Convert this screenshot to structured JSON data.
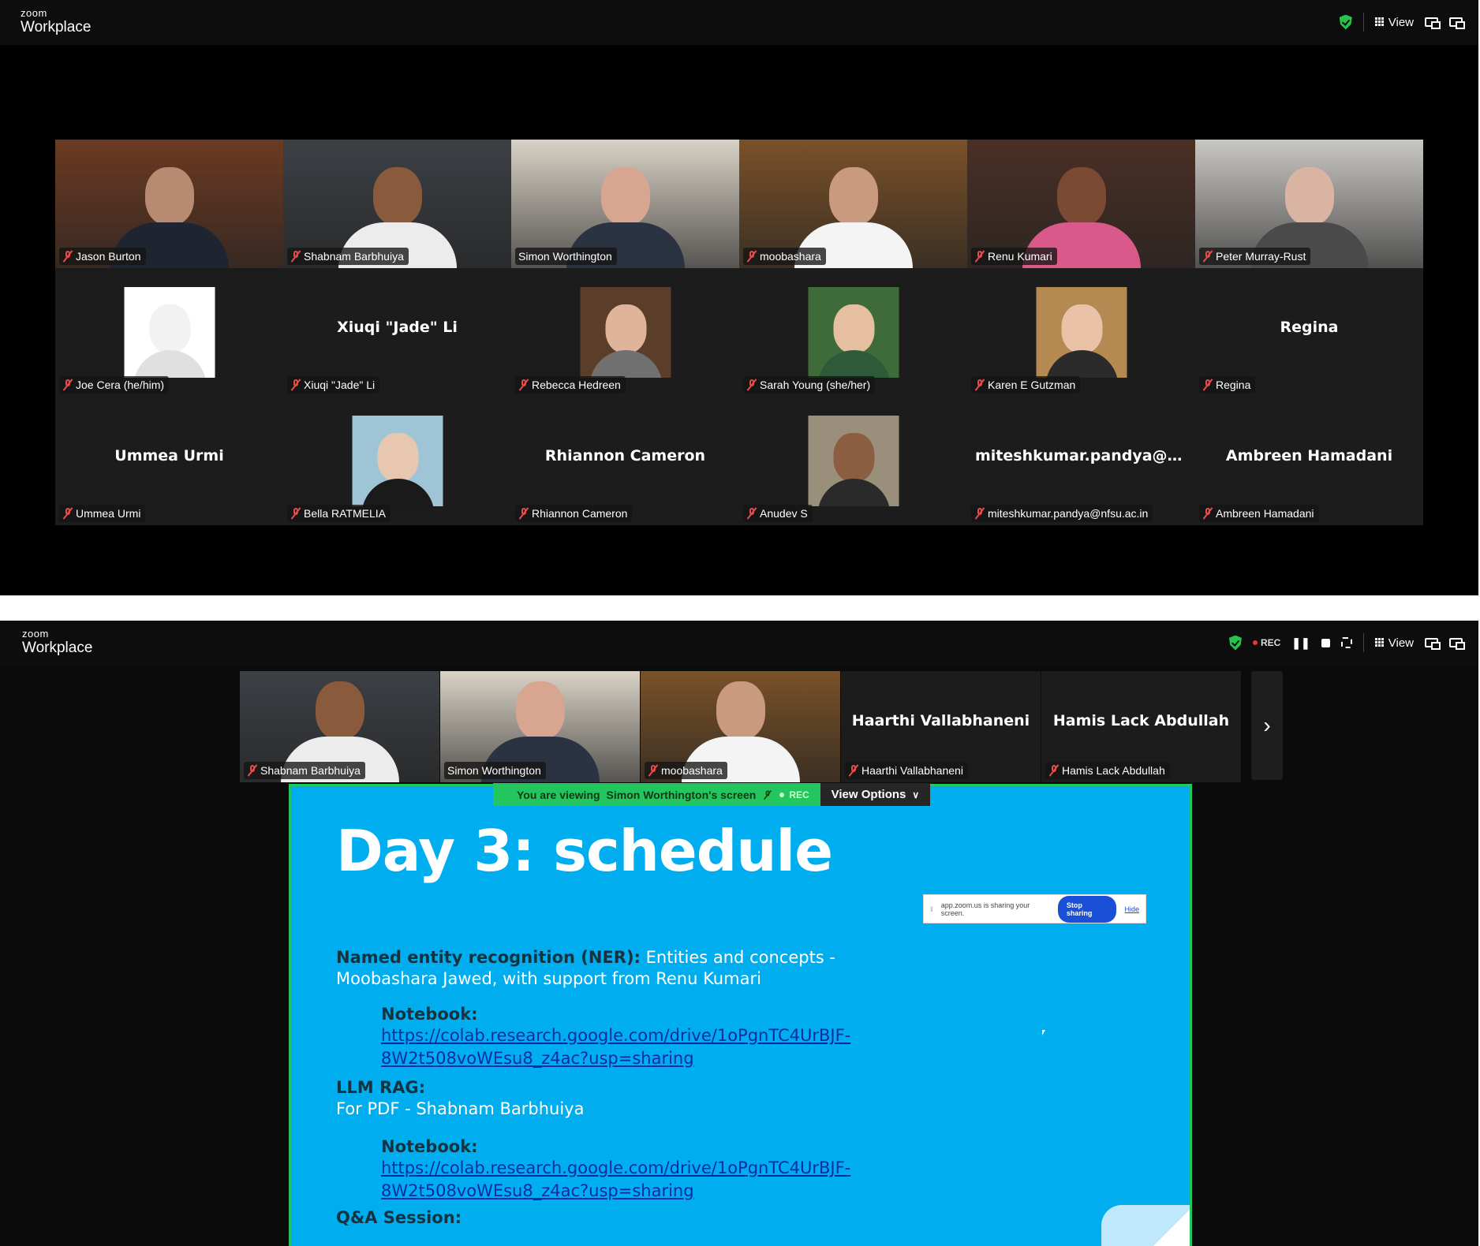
{
  "top_window": {
    "logo_small": "zoom",
    "logo_big": "Workplace",
    "view_label": "View",
    "participants": [
      {
        "name": "Jason Burton",
        "video": true,
        "bg": "#6b3a22",
        "head": "#b98a72",
        "body": "#1f2530"
      },
      {
        "name": "Shabnam Barbhuiya",
        "video": true,
        "bg": "#3c4045",
        "head": "#8a5a3c",
        "body": "#ececec"
      },
      {
        "name": "Simon Worthington",
        "video": true,
        "active": true,
        "bg": "#d9d2c6",
        "head": "#d8a590",
        "body": "#2b3242"
      },
      {
        "name": "moobashara",
        "video": true,
        "bg": "#7a5128",
        "head": "#c99a7e",
        "body": "#f4f4f4"
      },
      {
        "name": "Renu Kumari",
        "video": true,
        "bg": "#4a2f24",
        "head": "#7b4a34",
        "body": "#d95a8a"
      },
      {
        "name": "Peter Murray-Rust",
        "video": true,
        "bg": "#c9c7c3",
        "head": "#d9b4a2",
        "body": "#4a4a4a"
      },
      {
        "name": "Joe Cera (he/him)",
        "avatar": true,
        "av_bg": "#ffffff",
        "av_head": "#f2f2f2",
        "av_body": "#e0e0e0"
      },
      {
        "name": "Xiuqi \"Jade\" Li",
        "big": "Xiuqi \"Jade\" Li"
      },
      {
        "name": "Rebecca Hedreen",
        "avatar": true,
        "av_bg": "#5a3e2a",
        "av_head": "#e0b49a",
        "av_body": "#707070"
      },
      {
        "name": "Sarah Young (she/her)",
        "avatar": true,
        "av_bg": "#3f6b3a",
        "av_head": "#e6bfa0",
        "av_body": "#2f5a3a"
      },
      {
        "name": "Karen E Gutzman",
        "avatar": true,
        "av_bg": "#b58a52",
        "av_head": "#e9c2a8",
        "av_body": "#2b2b2b"
      },
      {
        "name": "Regina",
        "big": "Regina"
      },
      {
        "name": "Ummea Urmi",
        "big": "Ummea Urmi"
      },
      {
        "name": "Bella RATMELIA",
        "avatar": true,
        "av_bg": "#9fc4d6",
        "av_head": "#e8c7b0",
        "av_body": "#1a1a1a"
      },
      {
        "name": "Rhiannon Cameron",
        "big": "Rhiannon Cameron"
      },
      {
        "name": "Anudev S",
        "avatar": true,
        "av_bg": "#9a8f7a",
        "av_head": "#8b5e42",
        "av_body": "#2a2a2a"
      },
      {
        "name": "miteshkumar.pandya@nfsu.ac.in",
        "big": "miteshkumar.pandya@nfsu...."
      },
      {
        "name": "Ambreen Hamadani",
        "big": "Ambreen Hamadani"
      }
    ]
  },
  "bottom_window": {
    "logo_small": "zoom",
    "logo_big": "Workplace",
    "rec_label": "REC",
    "view_label": "View",
    "strip": [
      {
        "name": "Shabnam Barbhuiya",
        "video": true,
        "bg": "#3c4045",
        "head": "#8a5a3c",
        "body": "#ececec"
      },
      {
        "name": "Simon Worthington",
        "video": true,
        "active": true,
        "bg": "#d9d2c6",
        "head": "#d8a590",
        "body": "#2b3242"
      },
      {
        "name": "moobashara",
        "video": true,
        "bg": "#7a5128",
        "head": "#c99a7e",
        "body": "#f4f4f4"
      },
      {
        "name": "Haarthi Vallabhaneni",
        "big": "Haarthi Vallabhaneni"
      },
      {
        "name": "Hamis Lack Abdullah",
        "big": "Hamis Lack Abdullah"
      }
    ],
    "viewing_prefix": "You are viewing",
    "viewing_name": "Simon Worthington's screen",
    "viewing_rec": "REC",
    "view_options": "View Options",
    "slide": {
      "title": "Day 3: schedule",
      "ner_label": "Named entity recognition (NER):",
      "ner_rest": " Entities and concepts -",
      "ner_line2": "Moobashara Jawed, with support from Renu Kumari",
      "notebook_label": "Notebook:",
      "link_line1": "https://colab.research.google.com/drive/1oPgnTC4UrBJF-",
      "link_line2": "8W2t508voWEsu8_z4ac?usp=sharing",
      "rag_label": "LLM RAG:",
      "rag_line2": "For  PDF - Shabnam Barbhuiya",
      "notebook2_label": "Notebook:",
      "link2_line1": "https://colab.research.google.com/drive/1oPgnTC4UrBJF-",
      "link2_line2": "8W2t508voWEsu8_z4ac?usp=sharing",
      "qa_label": "Q&A Session:"
    },
    "share_bar": {
      "text": "app.zoom.us is sharing your screen.",
      "stop": "Stop sharing",
      "hide": "Hide"
    }
  }
}
